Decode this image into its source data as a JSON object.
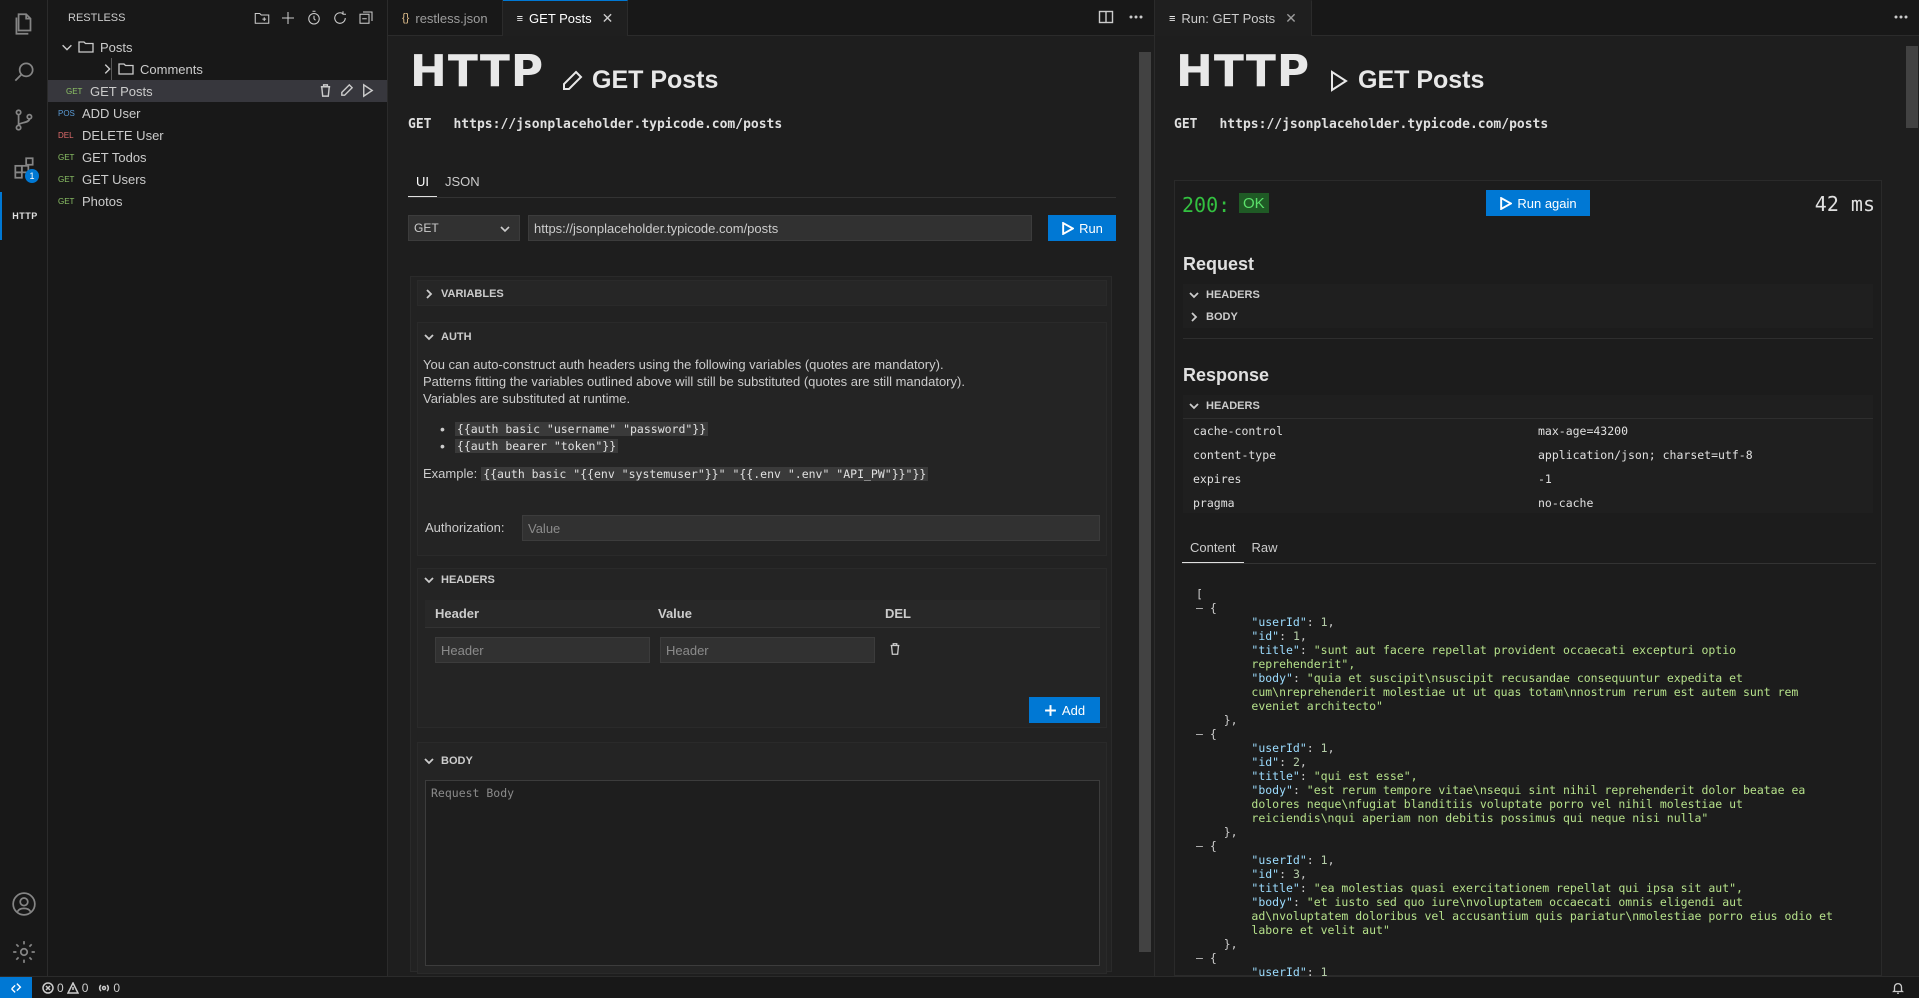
{
  "sidebar": {
    "title": "RESTLESS",
    "tree": [
      {
        "label": "Posts"
      },
      {
        "label": "Comments"
      },
      {
        "method": "GET",
        "label": "GET Posts"
      },
      {
        "method": "POS",
        "label": "ADD User"
      },
      {
        "method": "DEL",
        "label": "DELETE User"
      },
      {
        "method": "GET",
        "label": "GET Todos"
      },
      {
        "method": "GET",
        "label": "GET Users"
      },
      {
        "method": "GET",
        "label": "Photos"
      }
    ]
  },
  "activity": {
    "http_label": "HTTP",
    "badge": "1"
  },
  "editor1": {
    "tabs": [
      {
        "icon": "{}",
        "label": "restless.json"
      },
      {
        "icon": "≡",
        "label": "GET Posts",
        "close": "✕"
      }
    ],
    "title": "HTTP",
    "request_name": "GET Posts",
    "method": "GET",
    "url": "https://jsonplaceholder.typicode.com/posts",
    "subtabs": [
      "UI",
      "JSON"
    ],
    "method_select": "GET",
    "run_label": "Run",
    "variables_label": "VARIABLES",
    "auth_label": "AUTH",
    "auth_text": [
      "You can auto-construct auth headers using the following variables (quotes are mandatory).",
      "Patterns fitting the variables outlined above will still be substituted (quotes are still mandatory).",
      "Variables are substituted at runtime."
    ],
    "auth_patterns": [
      "{{auth basic \"username\" \"password\"}}",
      "{{auth bearer \"token\"}}"
    ],
    "example_label": "Example:",
    "example_code": "{{auth basic \"{{env \"systemuser\"}}\" \"{{.env \".env\" \"API_PW\"}}\"}}",
    "authorization_label": "Authorization:",
    "authorization_placeholder": "Value",
    "headers_label": "HEADERS",
    "columns": [
      "Header",
      "Value",
      "DEL"
    ],
    "header_placeholder": "Header",
    "value_placeholder": "Header",
    "add_label": "Add",
    "body_label": "BODY",
    "body_placeholder": "Request Body"
  },
  "editor2": {
    "tab_label": "Run: GET Posts",
    "tab_close": "✕",
    "title": "HTTP",
    "request_name": "GET Posts",
    "method": "GET",
    "url": "https://jsonplaceholder.typicode.com/posts",
    "status_code": "200:",
    "status_text": "OK",
    "run_again_label": "Run again",
    "duration": "42 ms",
    "request_heading": "Request",
    "request_sections": [
      "HEADERS",
      "BODY"
    ],
    "response_heading": "Response",
    "response_headers_label": "HEADERS",
    "response_headers": [
      {
        "key": "cache-control",
        "value": "max-age=43200"
      },
      {
        "key": "content-type",
        "value": "application/json; charset=utf-8"
      },
      {
        "key": "expires",
        "value": "-1"
      },
      {
        "key": "pragma",
        "value": "no-cache"
      }
    ],
    "content_tabs": [
      "Content",
      "Raw"
    ],
    "posts": [
      {
        "userId": 1,
        "id": 1,
        "title": "sunt aut facere repellat provident occaecati excepturi optio reprehenderit",
        "body": "quia et suscipit\\nsuscipit recusandae consequuntur expedita et cum\\nreprehenderit molestiae ut ut quas totam\\nnostrum rerum est autem sunt rem eveniet architecto",
        "title_lines": [
          "sunt aut facere repellat provident occaecati excepturi optio",
          "reprehenderit"
        ],
        "body_lines": [
          "quia et suscipit\\nsuscipit recusandae consequuntur expedita et",
          "cum\\nreprehenderit molestiae ut ut quas totam\\nnostrum rerum est autem sunt rem",
          "eveniet architecto"
        ]
      },
      {
        "userId": 1,
        "id": 2,
        "title": "qui est esse",
        "body": "est rerum tempore vitae\\nsequi sint nihil reprehenderit dolor beatae ea dolores neque\\nfugiat blanditiis voluptate porro vel nihil molestiae ut reiciendis\\nqui aperiam non debitis possimus qui neque nisi nulla",
        "title_lines": [
          "qui est esse"
        ],
        "body_lines": [
          "est rerum tempore vitae\\nsequi sint nihil reprehenderit dolor beatae ea",
          "dolores neque\\nfugiat blanditiis voluptate porro vel nihil molestiae ut",
          "reiciendis\\nqui aperiam non debitis possimus qui neque nisi nulla"
        ]
      },
      {
        "userId": 1,
        "id": 3,
        "title": "ea molestias quasi exercitationem repellat qui ipsa sit aut",
        "body": "et iusto sed quo iure\\nvoluptatem occaecati omnis eligendi aut ad\\nvoluptatem doloribus vel accusantium quis pariatur\\nmolestiae porro eius odio et labore et velit aut",
        "title_lines": [
          "ea molestias quasi exercitationem repellat qui ipsa sit aut"
        ],
        "body_lines": [
          "et iusto sed quo iure\\nvoluptatem occaecati omnis eligendi aut",
          "ad\\nvoluptatem doloribus vel accusantium quis pariatur\\nmolestiae porro eius odio et",
          "labore et velit aut"
        ]
      },
      {
        "userId": 1
      }
    ]
  },
  "statusbar": {
    "errors": "0",
    "warnings": "0",
    "ports": "0"
  }
}
